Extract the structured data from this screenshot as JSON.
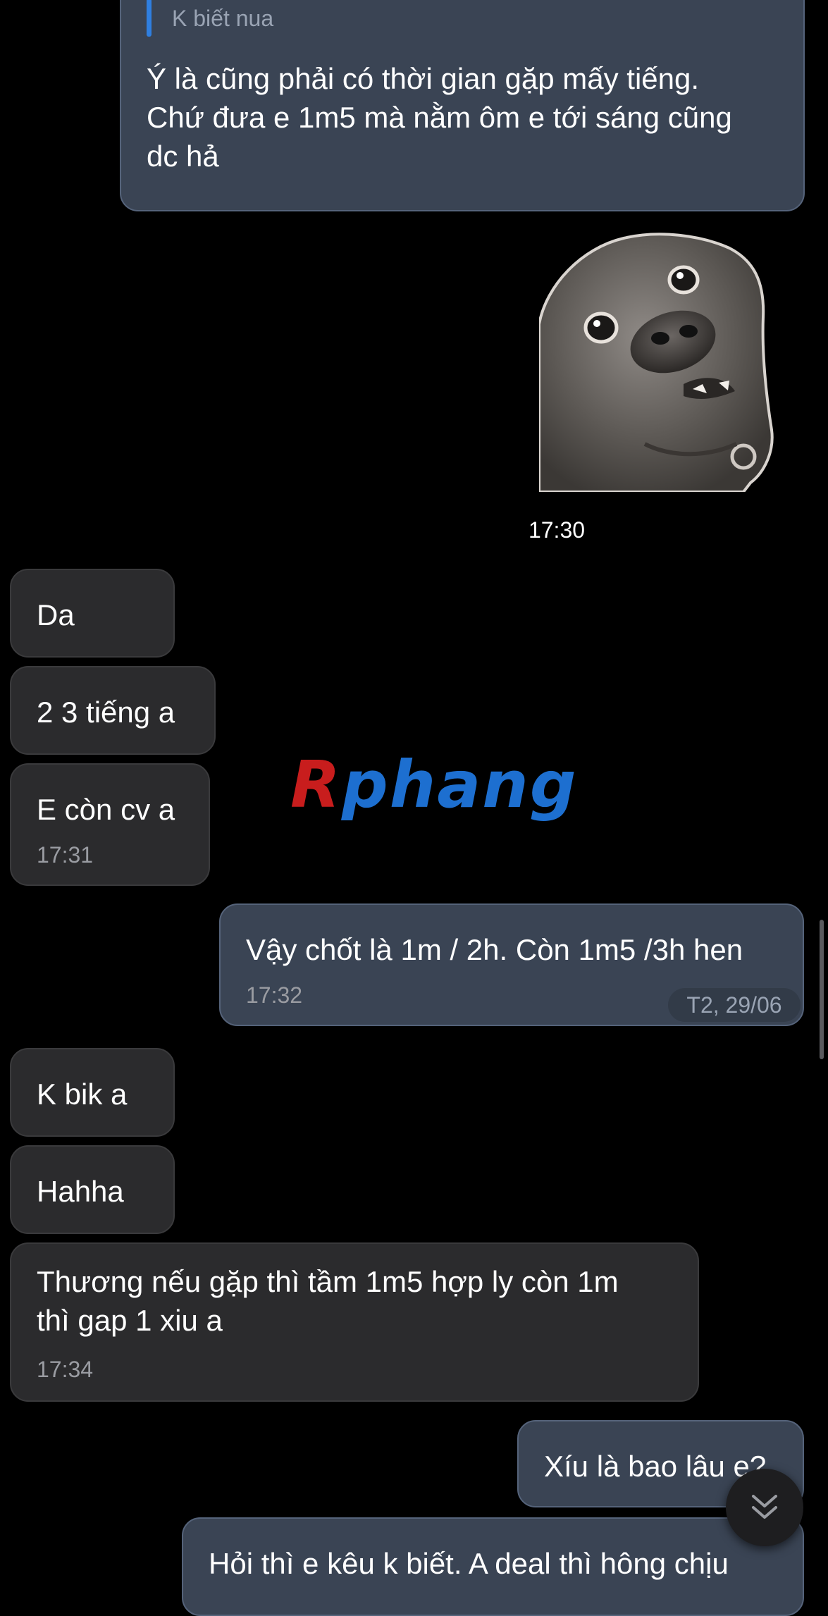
{
  "conversation": {
    "quoted_message": {
      "text": "K biết nua",
      "reply_text": "Ý là cũng phải có thời gian gặp mấy tiếng.\nChứ đưa e 1m5 mà nằm ôm e tới sáng cũng\ndc hả"
    },
    "sticker": {
      "icon": "dog-sticker",
      "time": "17:30"
    },
    "messages": [
      {
        "text": "Da",
        "direction": "in"
      },
      {
        "text": "2 3 tiếng a",
        "direction": "in"
      },
      {
        "text": "E còn cv a",
        "time": "17:31",
        "direction": "in"
      },
      {
        "text": "Vậy chốt là 1m / 2h. Còn 1m5 /3h hen",
        "time": "17:32",
        "direction": "out"
      },
      {
        "text": "K bik a",
        "direction": "in"
      },
      {
        "text": "Hahha",
        "direction": "in"
      },
      {
        "text": "Thương  nếu gặp thì tầm 1m5 hợp ly  còn 1m\nthì gap 1 xiu a",
        "time": "17:34",
        "direction": "in"
      },
      {
        "text": "Xíu là bao lâu e?",
        "direction": "out"
      },
      {
        "text": "Hỏi thì e kêu k biết. A deal thì hông chịu",
        "direction": "out"
      }
    ],
    "date_badge": "T2, 29/06"
  },
  "watermark": {
    "first_letter": "R",
    "rest": "phang"
  },
  "scroll_button": {
    "icon": "chevrons-down-icon"
  },
  "colors": {
    "background": "#000000",
    "outgoing_bubble": "#3a4454",
    "incoming_bubble": "#2b2b2d",
    "quote_accent": "#2f7fe0",
    "watermark_red": "#c81d1d",
    "watermark_blue": "#1d6fd0"
  }
}
